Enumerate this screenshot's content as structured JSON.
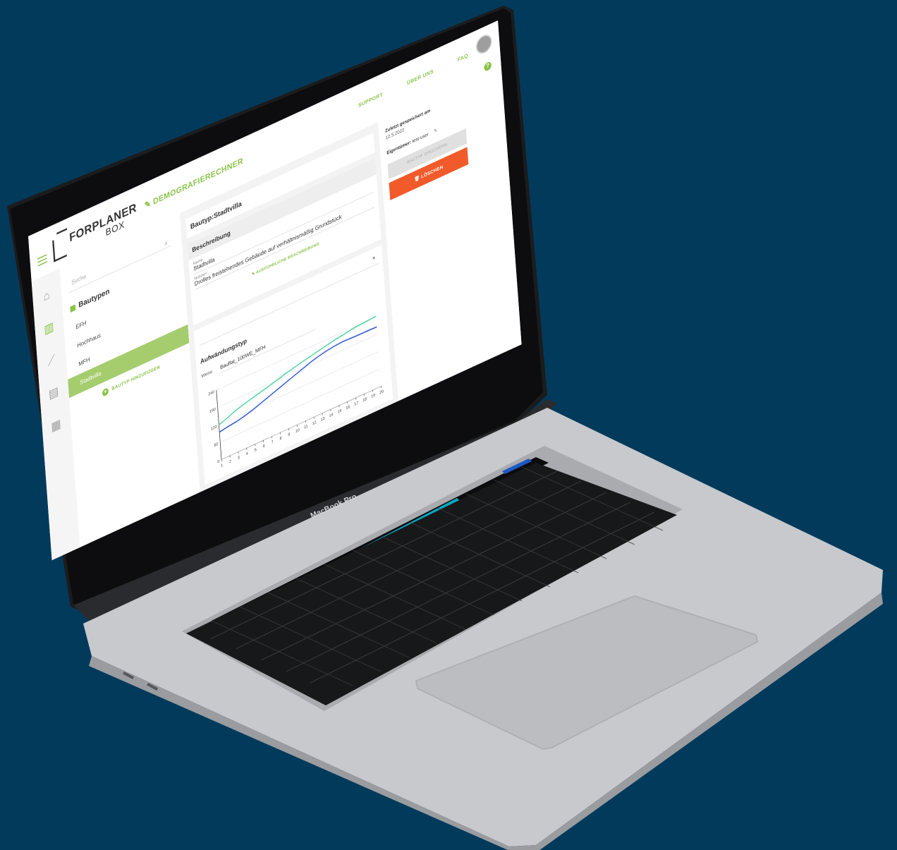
{
  "device": {
    "brand_label": "MacBook Pro"
  },
  "colors": {
    "background": "#023a5c",
    "accent": "#8bc34a",
    "danger": "#f15a2b",
    "line_green": "#4cd3a0",
    "line_blue": "#2f56d8"
  },
  "header": {
    "logo_top": "FORPLANER",
    "logo_bottom": "BOX",
    "app_title": "DEMOGRAFIERECHNER",
    "nav": [
      "SUPPORT",
      "ÜBER UNS",
      "FAQ"
    ],
    "help": "?"
  },
  "rail_icons": [
    "home-icon",
    "building-icon",
    "chart-icon",
    "clipboard-icon",
    "city-chart-icon"
  ],
  "sidebar": {
    "search_placeholder": "Suche",
    "section_title": "Bautypen",
    "items": [
      {
        "label": "EFH",
        "active": false
      },
      {
        "label": "Hochhaus",
        "active": false
      },
      {
        "label": "MFH",
        "active": false
      },
      {
        "label": "Stadtvilla",
        "active": true
      }
    ],
    "add_button": "BAUTYP HINZUFÜGEN"
  },
  "main": {
    "title": "Bautyp:Stadtvilla",
    "description_header": "Beschreibung",
    "name_label": "Name",
    "name_value": "Stadtvilla",
    "desc_label": "Notizen",
    "desc_value": "Drolles freistehendes Gebäude auf verhältnismäßig Grundstück",
    "more_link": "AUSFÜHRLICHE BESCHREIBUNG",
    "chart_section": "Aufwändungstyp",
    "row_label": "Werte",
    "row_value": "Bauflat_100WE_MFH"
  },
  "chart_data": {
    "type": "line",
    "x": [
      1,
      2,
      3,
      4,
      5,
      6,
      7,
      8,
      9,
      10,
      11,
      12,
      13,
      14,
      15,
      16,
      17,
      18,
      19,
      20
    ],
    "ylim": [
      0,
      240
    ],
    "yticks": [
      0,
      60,
      120,
      180,
      240
    ],
    "series": [
      {
        "values": [
          120,
          130,
          142,
          150,
          158,
          165,
          172,
          180,
          188,
          195,
          202,
          208,
          214,
          220,
          226,
          230,
          235,
          238,
          240,
          242
        ]
      },
      {
        "values": [
          95,
          100,
          104,
          110,
          118,
          128,
          138,
          148,
          158,
          168,
          178,
          188,
          196,
          202,
          206,
          208,
          207,
          206,
          206,
          205
        ]
      }
    ]
  },
  "right_panel": {
    "saved_label": "Zuletzt gespeichert am",
    "saved_date": "12.5.2022",
    "owner_label": "Eigentümer:",
    "owner_value": "test-user",
    "save_button": "BAUTYP SPEICHERN",
    "delete_button": "LÖSCHEN"
  }
}
